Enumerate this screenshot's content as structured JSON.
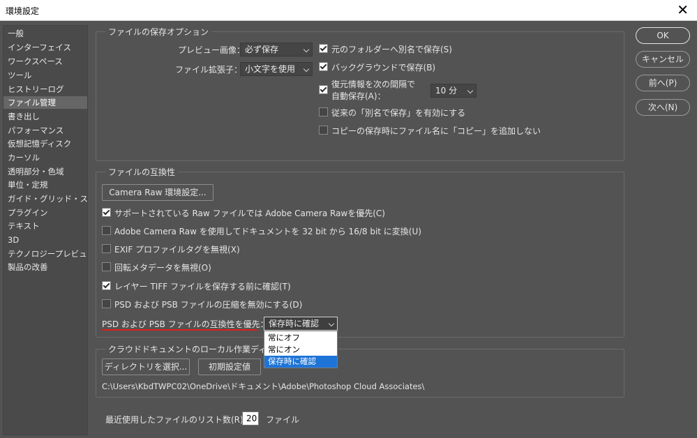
{
  "window": {
    "title": "環境設定"
  },
  "sidebar": {
    "items": [
      {
        "label": "一般"
      },
      {
        "label": "インターフェイス"
      },
      {
        "label": "ワークスペース"
      },
      {
        "label": "ツール"
      },
      {
        "label": "ヒストリーログ"
      },
      {
        "label": "ファイル管理"
      },
      {
        "label": "書き出し"
      },
      {
        "label": "パフォーマンス"
      },
      {
        "label": "仮想記憶ディスク"
      },
      {
        "label": "カーソル"
      },
      {
        "label": "透明部分・色域"
      },
      {
        "label": "単位・定規"
      },
      {
        "label": "ガイド・グリッド・スライス"
      },
      {
        "label": "プラグイン"
      },
      {
        "label": "テキスト"
      },
      {
        "label": "3D"
      },
      {
        "label": "テクノロジープレビュー"
      },
      {
        "label": "製品の改善"
      }
    ],
    "active": "ファイル管理"
  },
  "save_options": {
    "title": "ファイルの保存オプション",
    "preview_label": "プレビュー画像：",
    "preview_value": "必ず保存",
    "ext_label": "ファイル拡張子：",
    "ext_value": "小文字を使用",
    "cb_save_original_folder": "元のフォルダーへ別名で保存(S)",
    "cb_background_save": "バックグラウンドで保存(B)",
    "cb_autosave_line1": "復元情報を次の間隔で",
    "cb_autosave_line2": "自動保存(A)：",
    "autosave_value": "10 分",
    "cb_legacy_save_as": "従来の「別名で保存」を有効にする",
    "cb_no_copy_suffix": "コピーの保存時にファイル名に「コピー」を追加しない"
  },
  "compat": {
    "title": "ファイルの互換性",
    "camera_raw_button": "Camera Raw 環境設定...",
    "cb_prefer_acr": "サポートされている Raw ファイルでは Adobe Camera Rawを優先(C)",
    "cb_convert_bit": "Adobe Camera Raw を使用してドキュメントを 32 bit から 16/8 bit に変換(U)",
    "cb_ignore_exif": "EXIF プロファイルタグを無視(X)",
    "cb_ignore_rotation": "回転メタデータを無視(O)",
    "cb_ask_tiff": "レイヤー TIFF ファイルを保存する前に確認(T)",
    "cb_disable_compression": "PSD および PSB ファイルの圧縮を無効にする(D)",
    "maximize_label": "PSD および PSB ファイルの互換性を優先：",
    "maximize_value": "保存時に確認",
    "maximize_options": [
      "常にオフ",
      "常にオン",
      "保存時に確認"
    ]
  },
  "cloud": {
    "title": "クラウドドキュメントのローカル作業ディレクトリ",
    "choose_button": "ディレクトリを選択...",
    "default_button": "初期設定値",
    "path": "C:\\Users\\KbdTWPC02\\OneDrive\\ドキュメント\\Adobe\\Photoshop Cloud Associates\\"
  },
  "recent": {
    "label": "最近使用したファイルのリスト数(R)：",
    "value": "20",
    "unit": "ファイル"
  },
  "buttons": {
    "ok": "OK",
    "cancel": "キャンセル",
    "prev": "前へ(P)",
    "next": "次へ(N)"
  },
  "colors": {
    "background": "#535353",
    "highlight": "#1e74d6",
    "annotation": "#e01d1d"
  }
}
